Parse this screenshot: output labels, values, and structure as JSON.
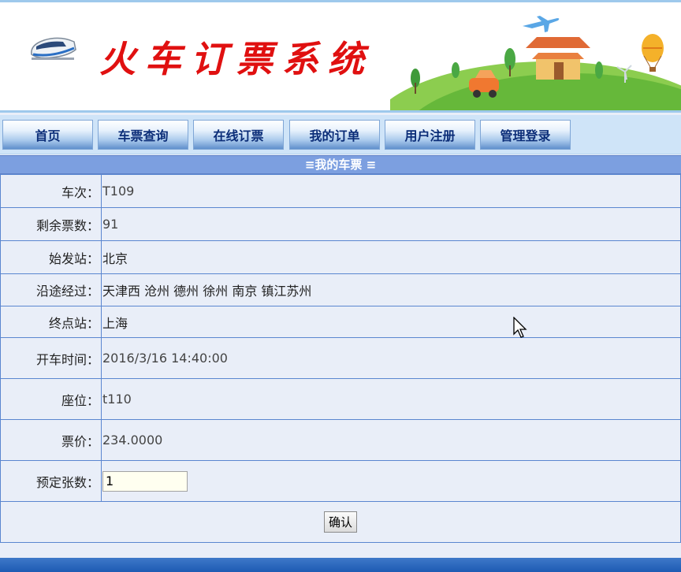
{
  "header": {
    "site_title": "火车订票系统"
  },
  "nav": {
    "items": [
      {
        "label": "首页",
        "name": "nav-home"
      },
      {
        "label": "车票查询",
        "name": "nav-ticket-query"
      },
      {
        "label": "在线订票",
        "name": "nav-online-booking"
      },
      {
        "label": "我的订单",
        "name": "nav-my-orders"
      },
      {
        "label": "用户注册",
        "name": "nav-register"
      },
      {
        "label": "管理登录",
        "name": "nav-admin-login"
      }
    ]
  },
  "section": {
    "title": "≡我的车票 ≡"
  },
  "ticket": {
    "train_no_label": "车次：",
    "train_no": "T109",
    "remaining_label": "剩余票数：",
    "remaining": "91",
    "origin_label": "始发站：",
    "origin": "北京",
    "via_label": "沿途经过：",
    "via": "天津西 沧州 德州 徐州 南京 镇江苏州",
    "terminal_label": "终点站：",
    "terminal": "上海",
    "depart_label": "开车时间：",
    "depart": "2016/3/16 14:40:00",
    "seat_label": "座位：",
    "seat": "t110",
    "price_label": "票价：",
    "price": "234.0000",
    "qty_label": "预定张数：",
    "qty_value": "1"
  },
  "actions": {
    "confirm_label": "确认"
  },
  "colors": {
    "title_red": "#e01010",
    "nav_text": "#0b2d78",
    "section_bar": "#7c9fe0",
    "border_blue": "#5a86d0"
  }
}
